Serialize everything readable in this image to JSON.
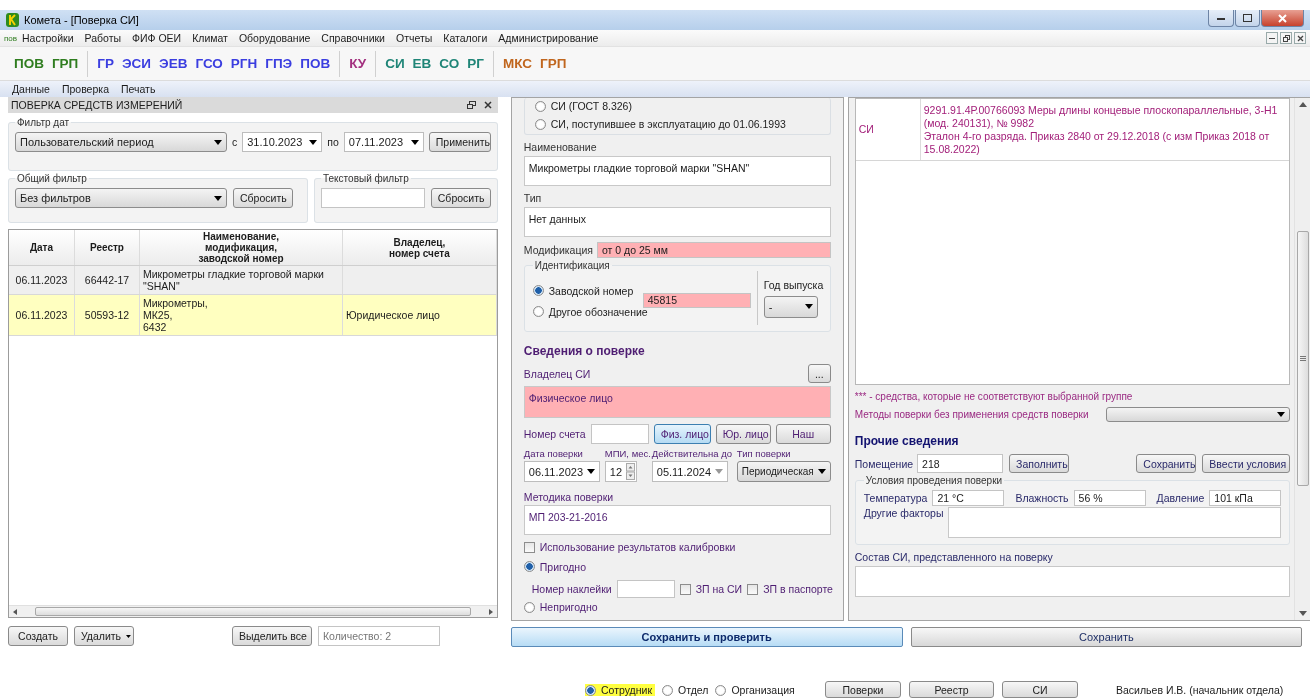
{
  "window": {
    "title": "Комета - [Поверка СИ]"
  },
  "menu": {
    "badge": "пов",
    "items": [
      "Настройки",
      "Работы",
      "ФИФ ОЕИ",
      "Климат",
      "Оборудование",
      "Справочники",
      "Отчеты",
      "Каталоги",
      "Администрирование"
    ]
  },
  "toolbar": [
    {
      "color": "#2f7d1f",
      "items": [
        "ПОВ",
        "ГРП"
      ]
    },
    {
      "color": "#3b3ee0",
      "items": [
        "ГР",
        "ЭСИ",
        "ЭЕВ",
        "ГСО",
        "РГН",
        "ГПЭ",
        "ПОВ"
      ]
    },
    {
      "color": "#a3307f",
      "items": [
        "КУ"
      ]
    },
    {
      "color": "#1f8577",
      "items": [
        "СИ",
        "ЕВ",
        "СО",
        "РГ"
      ]
    },
    {
      "color": "#c0661e",
      "items": [
        "МКС",
        "ГРП"
      ]
    }
  ],
  "submenu": [
    "Данные",
    "Проверка",
    "Печать"
  ],
  "left_panel": {
    "title": "ПОВЕРКА СРЕДСТВ ИЗМЕРЕНИЙ",
    "date_filter": {
      "legend": "Фильтр дат",
      "period": "Пользовательский период",
      "from_label": "с",
      "from": "31.10.2023",
      "to_label": "по",
      "to": "07.11.2023",
      "apply": "Применить"
    },
    "general_filter": {
      "legend": "Общий фильтр",
      "value": "Без фильтров",
      "reset": "Сбросить"
    },
    "text_filter": {
      "legend": "Текстовый фильтр",
      "reset": "Сбросить"
    },
    "table": {
      "columns": [
        "Дата",
        "Реестр",
        "Наименование,\nмодификация,\nзаводской номер",
        "Владелец,\nномер счета"
      ],
      "rows": [
        {
          "selected": false,
          "cells": [
            "06.11.2023",
            "66442-17",
            "Микрометры гладкие торговой марки \"SHAN\"",
            ""
          ]
        },
        {
          "selected": true,
          "cells": [
            "06.11.2023",
            "50593-12",
            "Микрометры,\nМК25,\n6432",
            "Юридическое лицо"
          ]
        }
      ]
    },
    "create": "Создать",
    "delete": "Удалить",
    "select_all": "Выделить все",
    "count": "Количество: 2"
  },
  "si_form": {
    "type_options": [
      {
        "label": "СИ (ГОСТ 8.326)",
        "selected": false
      },
      {
        "label": "СИ, поступившее в эксплуатацию до 01.06.1993",
        "selected": false
      }
    ],
    "name_label": "Наименование",
    "name": "Микрометры гладкие торговой марки \"SHAN\"",
    "type_label": "Тип",
    "type": "Нет данных",
    "mod_label": "Модификация",
    "mod": "от 0 до 25 мм",
    "ident": {
      "legend": "Идентификация",
      "options": [
        {
          "label": "Заводской номер",
          "selected": true
        },
        {
          "label": "Другое обозначение",
          "selected": false
        }
      ],
      "serial": "45815",
      "year_label": "Год выпуска",
      "year": "-"
    }
  },
  "verification": {
    "title": "Сведения о поверке",
    "owner_label": "Владелец СИ",
    "owner_button": "...",
    "owner": "Физическое лицо",
    "account_label": "Номер счета",
    "owner_types": [
      {
        "label": "Физ. лицо",
        "selected": true
      },
      {
        "label": "Юр. лицо",
        "selected": false
      },
      {
        "label": "Наш",
        "selected": false
      }
    ],
    "date_label": "Дата поверки",
    "date": "06.11.2023",
    "mpi_label": "МПИ, мес.",
    "mpi": "12",
    "valid_label": "Действительна до",
    "valid": "05.11.2024",
    "kind_label": "Тип поверки",
    "kind": "Периодическая",
    "method_label": "Методика поверки",
    "method": "МП 203-21-2016",
    "calibration": {
      "label": "Использование результатов калибровки",
      "checked": false
    },
    "results": [
      {
        "label": "Пригодно",
        "selected": true
      },
      {
        "label": "Непригодно",
        "selected": false
      }
    ],
    "sticker_label": "Номер наклейки",
    "marks": [
      {
        "label": "ЗП на СИ",
        "checked": false
      },
      {
        "label": "ЗП в паспорте",
        "checked": false
      }
    ]
  },
  "standards": {
    "rows": [
      {
        "kind": "СИ",
        "lines": [
          "9291.91.4Р.00766093 Меры длины концевые плоскопараллельные, 3-Н1 (мод. 240131), № 9982",
          "Эталон 4-го разряда. Приказ 2840 от 29.12.2018 (с изм Приказ 2018 от 15.08.2022)"
        ]
      }
    ],
    "note": "*** - средства, которые не соответствуют выбранной группе",
    "methods_label": "Методы поверки без применения средств поверки"
  },
  "other": {
    "title": "Прочие сведения",
    "room_label": "Помещение",
    "room": "218",
    "fill": "Заполнить",
    "save": "Сохранить",
    "enter": "Ввести условия",
    "conditions": {
      "legend": "Условия проведения поверки",
      "temp_label": "Температура",
      "temp": "21 °С",
      "hum_label": "Влажность",
      "hum": "56 %",
      "press_label": "Давление",
      "press": "101 кПа",
      "other_label": "Другие факторы"
    },
    "composition_label": "Состав СИ, представленного на поверку"
  },
  "actions": {
    "save_check": "Сохранить и проверить",
    "save": "Сохранить"
  },
  "footer": {
    "scope": [
      {
        "label": "Сотрудник",
        "selected": true
      },
      {
        "label": "Отдел",
        "selected": false
      },
      {
        "label": "Организация",
        "selected": false
      }
    ],
    "buttons": [
      "Поверки",
      "Реестр",
      "СИ"
    ],
    "user": "Васильев И.В. (начальник отдела)"
  }
}
